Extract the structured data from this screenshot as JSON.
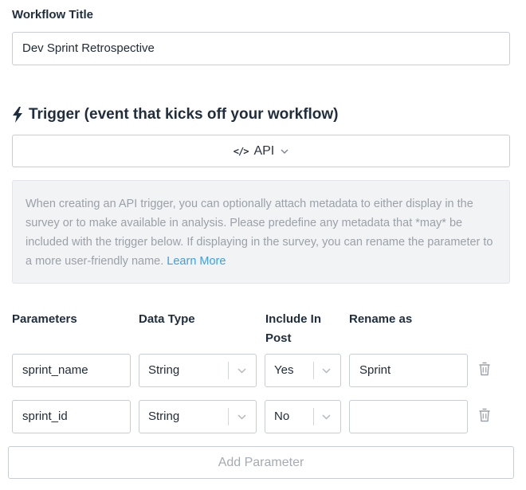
{
  "workflow": {
    "title_label": "Workflow Title",
    "title_value": "Dev Sprint Retrospective"
  },
  "trigger": {
    "heading": "Trigger (event that kicks off your workflow)",
    "icon": "lightning-bolt-icon",
    "selected_type": "API",
    "selected_type_icon": "code-icon"
  },
  "info": {
    "text": "When creating an API trigger, you can optionally attach metadata to either display in the survey or to make available in analysis. Please predefine any metadata that *may* be included with the trigger below. If displaying in the survey, you can rename the parameter to a more user-friendly name. ",
    "link_text": "Learn More",
    "link_color": "#3aa0e8"
  },
  "parameters": {
    "headers": {
      "parameters": "Parameters",
      "data_type": "Data Type",
      "include_in_post_line1": "Include In",
      "include_in_post_line2": "Post",
      "rename_as": "Rename as"
    },
    "rows": [
      {
        "name": "sprint_name",
        "data_type": "String",
        "include_in_post": "Yes",
        "rename_as": "Sprint"
      },
      {
        "name": "sprint_id",
        "data_type": "String",
        "include_in_post": "No",
        "rename_as": ""
      }
    ],
    "add_button_label": "Add Parameter"
  }
}
